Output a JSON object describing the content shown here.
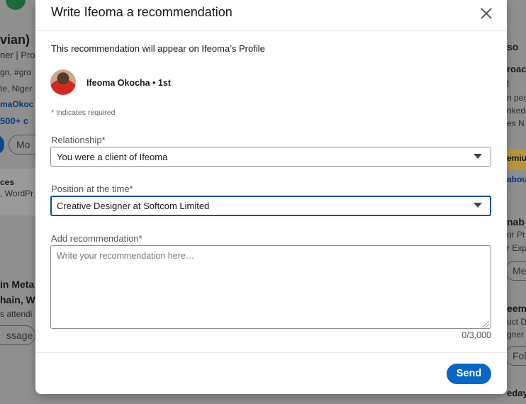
{
  "background": {
    "left": [
      "vian)",
      "ner | Pro",
      "gn, #gro",
      "te, Niger",
      "maOkoc",
      "500+ c",
      "Mo",
      "ces",
      ", WordPr",
      "in Meta",
      "hain, We",
      "s attendi",
      "ssage"
    ],
    "right": [
      "so",
      "roac",
      "t",
      "n peop",
      "nked",
      "es N",
      "emiu",
      "abou",
      "nab",
      "or Pr",
      "r Exp",
      "Me",
      "eem",
      "uct D",
      "gner",
      "Fol",
      "edayo"
    ]
  },
  "modal": {
    "title": "Write Ifeoma a recommendation",
    "intro": "This recommendation will appear on Ifeoma’s Profile",
    "person_name": "Ifeoma Okocha • 1st",
    "required_note": "* Indicates required",
    "relationship": {
      "label": "Relationship*",
      "value": "You were a client of Ifeoma"
    },
    "position": {
      "label": "Position at the time*",
      "value": "Creative Designer at Softcom Limited"
    },
    "recommendation": {
      "label": "Add recommendation*",
      "placeholder": "Write your recommendation here…",
      "counter": "0/3,000"
    },
    "send_label": "Send"
  },
  "colors": {
    "primary": "#0a66c2",
    "focus_border": "#0a4e9b"
  },
  "icons": {
    "close": "close-icon",
    "dropdown": "chevron-down-icon"
  }
}
